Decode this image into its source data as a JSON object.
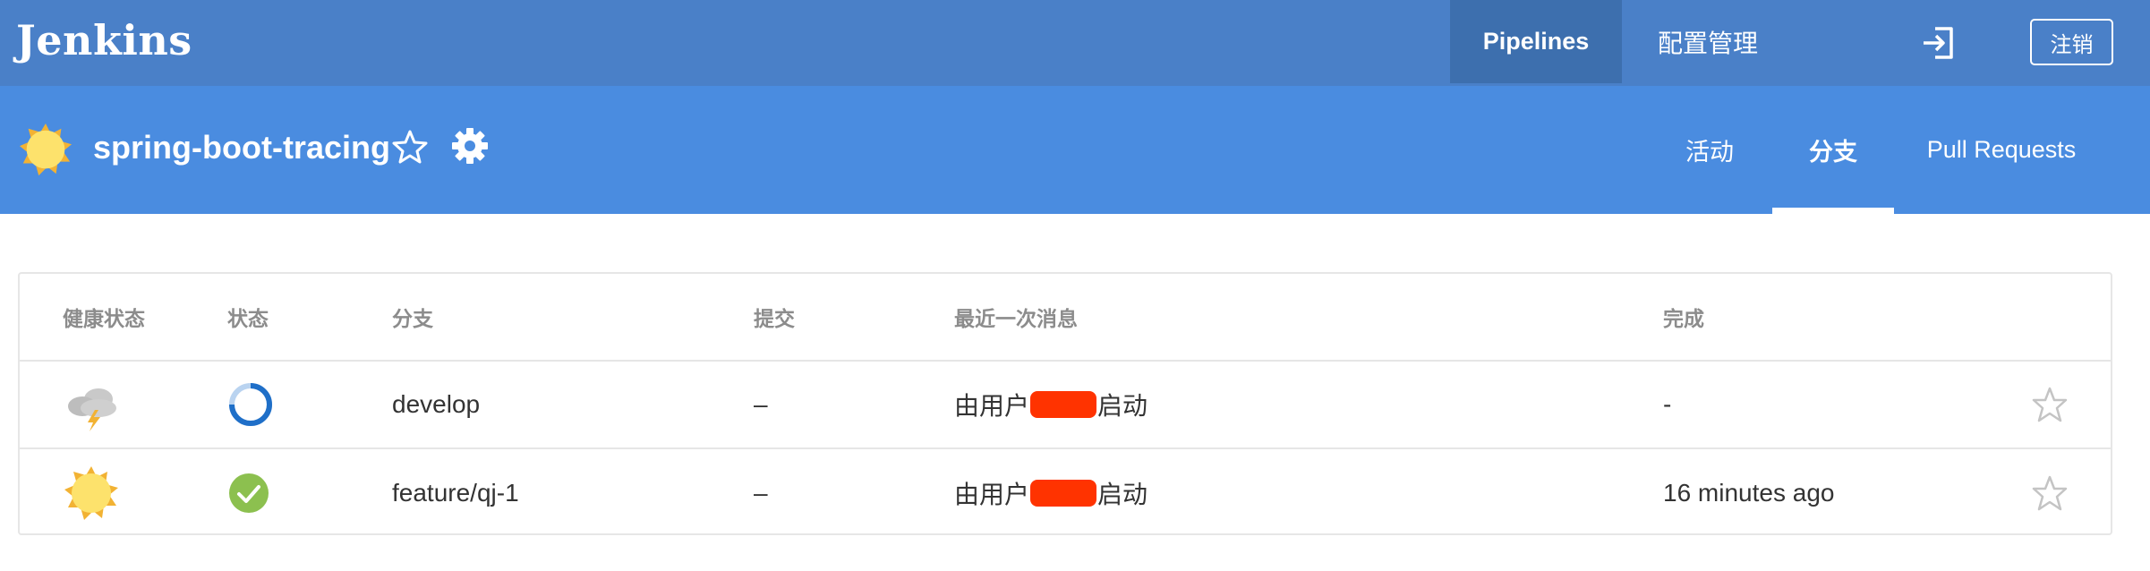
{
  "app": {
    "name": "Jenkins"
  },
  "topnav": {
    "pipelines_label": "Pipelines",
    "config_label": "配置管理",
    "logout_label": "注销",
    "login_icon": "sign-in-icon"
  },
  "pipeline": {
    "name": "spring-boot-tracing",
    "health_icon": "sun-icon",
    "favorite_icon": "star-outline-icon",
    "settings_icon": "gear-icon"
  },
  "tabs": [
    {
      "label": "活动",
      "active": false
    },
    {
      "label": "分支",
      "active": true
    },
    {
      "label": "Pull Requests",
      "active": false
    }
  ],
  "table": {
    "headers": {
      "health": "健康状态",
      "status": "状态",
      "branch": "分支",
      "commit": "提交",
      "message": "最近一次消息",
      "completed": "完成"
    },
    "rows": [
      {
        "health_icon": "storm-cloud-icon",
        "status_icon": "running-spinner-icon",
        "branch": "develop",
        "commit": "–",
        "message_prefix": "由用户",
        "message_suffix": "启动",
        "completed": "-",
        "favorite_icon": "star-outline-icon"
      },
      {
        "health_icon": "sun-icon",
        "status_icon": "success-check-icon",
        "branch": "feature/qj-1",
        "commit": "–",
        "message_prefix": "由用户",
        "message_suffix": "启动",
        "completed": "16 minutes ago",
        "favorite_icon": "star-outline-icon"
      }
    ]
  },
  "colors": {
    "topbar": "#4a80c8",
    "subbar": "#4a8ce0",
    "active_nav": "#3d6fae",
    "success": "#8cc04f",
    "running": "#1f6fc8",
    "redaction": "#ff3300"
  }
}
